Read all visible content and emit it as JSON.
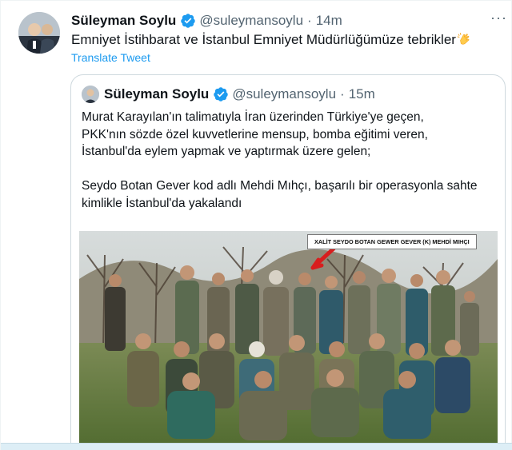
{
  "tweet": {
    "author_name": "Süleyman Soylu",
    "author_handle": "@suleymansoylu",
    "separator": "·",
    "timestamp": "14m",
    "more_label": "···",
    "text": "Emniyet İstihbarat ve İstanbul Emniyet Müdürlüğümüze tebrikler",
    "emoji": "clapping-hands",
    "translate_label": "Translate Tweet"
  },
  "quoted": {
    "author_name": "Süleyman Soylu",
    "author_handle": "@suleymansoylu",
    "separator": "·",
    "timestamp": "15m",
    "lines": [
      "Murat Karayılan'ın talimatıyla İran üzerinden Türkiye'ye geçen,",
      "PKK'nın sözde özel kuvvetlerine mensup, bomba eğitimi veren,",
      "İstanbul'da eylem yapmak ve yaptırmak üzere gelen;",
      "",
      "Seydo Botan Gever kod adlı Mehdi Mıhçı, başarılı bir operasyonla sahte",
      "kimlikle İstanbul'da yakalandı"
    ],
    "photo_caption": "XALİT SEYDO BOTAN GEWER GEVER (K) MEHDİ MIHÇI"
  },
  "colors": {
    "accent": "#1d9bf0",
    "muted": "#536471",
    "text": "#0f1419",
    "border": "#cfd9de"
  }
}
